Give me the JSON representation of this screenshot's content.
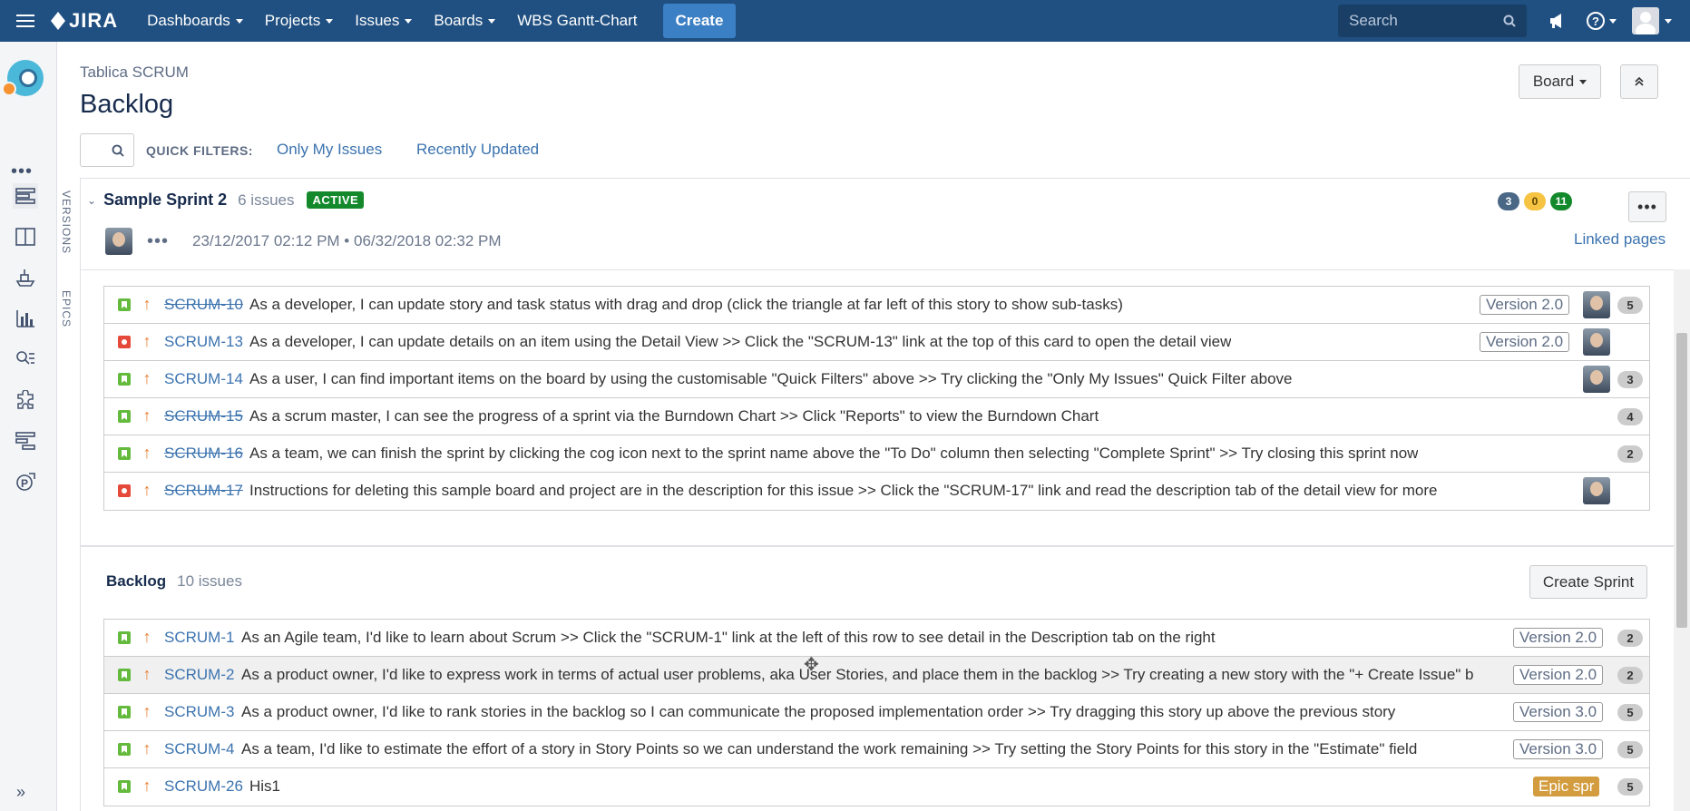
{
  "nav": {
    "logo": "JIRA",
    "items": [
      {
        "label": "Dashboards",
        "has_caret": true
      },
      {
        "label": "Projects",
        "has_caret": true
      },
      {
        "label": "Issues",
        "has_caret": true
      },
      {
        "label": "Boards",
        "has_caret": true
      },
      {
        "label": "WBS Gantt-Chart",
        "has_caret": false
      }
    ],
    "create_label": "Create",
    "search_placeholder": "Search",
    "icons": [
      "megaphone-icon",
      "help-icon",
      "user-avatar"
    ]
  },
  "sidebar": {
    "project_avatar": "project-avatar",
    "icons": [
      "backlog-icon",
      "board-icon",
      "releases-icon",
      "reports-icon",
      "issues-search-icon",
      "components-icon",
      "tests-icon",
      "plugin-icon"
    ],
    "expand_icon": "expand-sidebar-icon"
  },
  "vertical_tabs": [
    "VERSIONS",
    "EPICS"
  ],
  "header": {
    "breadcrumb": "Tablica SCRUM",
    "title": "Backlog",
    "board_button": "Board",
    "quick_filters_label": "QUICK FILTERS:",
    "quick_filters": [
      "Only My Issues",
      "Recently Updated"
    ]
  },
  "sprint": {
    "name": "Sample Sprint 2",
    "issue_count": "6 issues",
    "state": "ACTIVE",
    "dates": "23/12/2017 02:12 PM • 06/32/2018 02:32 PM",
    "status_counts": [
      {
        "value": "3",
        "color": "#4a6785"
      },
      {
        "value": "0",
        "color": "#f6c342"
      },
      {
        "value": "11",
        "color": "#14892c"
      }
    ],
    "linked_pages": "Linked pages",
    "issues": [
      {
        "type": "story",
        "key": "SCRUM-10",
        "done": true,
        "summary": "As a developer, I can update story and task status with drag and drop (click the triangle at far left of this story to show sub-tasks)",
        "version": "Version 2.0",
        "assignee": true,
        "points": "5"
      },
      {
        "type": "bug",
        "key": "SCRUM-13",
        "done": false,
        "summary": "As a developer, I can update details on an item using the Detail View >> Click the \"SCRUM-13\" link at the top of this card to open the detail view",
        "version": "Version 2.0",
        "assignee": true,
        "points": ""
      },
      {
        "type": "story",
        "key": "SCRUM-14",
        "done": false,
        "summary": "As a user, I can find important items on the board by using the customisable \"Quick Filters\" above >> Try clicking the \"Only My Issues\" Quick Filter above",
        "version": "",
        "assignee": true,
        "points": "3"
      },
      {
        "type": "story",
        "key": "SCRUM-15",
        "done": true,
        "summary": "As a scrum master, I can see the progress of a sprint via the Burndown Chart >> Click \"Reports\" to view the Burndown Chart",
        "version": "",
        "assignee": false,
        "points": "4"
      },
      {
        "type": "story",
        "key": "SCRUM-16",
        "done": true,
        "summary": "As a team, we can finish the sprint by clicking the cog icon next to the sprint name above the \"To Do\" column then selecting \"Complete Sprint\" >> Try closing this sprint now",
        "version": "",
        "assignee": false,
        "points": "2"
      },
      {
        "type": "bug",
        "key": "SCRUM-17",
        "done": true,
        "summary": "Instructions for deleting this sample board and project are in the description for this issue >> Click the \"SCRUM-17\" link and read the description tab of the detail view for more",
        "version": "",
        "assignee": true,
        "points": ""
      }
    ]
  },
  "backlog": {
    "title": "Backlog",
    "issue_count": "10 issues",
    "create_sprint": "Create Sprint",
    "issues": [
      {
        "type": "story",
        "key": "SCRUM-1",
        "done": false,
        "summary": "As an Agile team, I'd like to learn about Scrum >> Click the \"SCRUM-1\" link at the left of this row to see detail in the Description tab on the right",
        "version": "Version 2.0",
        "epic": "",
        "points": "2"
      },
      {
        "type": "story",
        "key": "SCRUM-2",
        "done": false,
        "summary": "As a product owner, I'd like to express work in terms of actual user problems, aka User Stories, and place them in the backlog >> Try creating a new story with the \"+ Create Issue\" b",
        "version": "Version 2.0",
        "epic": "",
        "points": "2"
      },
      {
        "type": "story",
        "key": "SCRUM-3",
        "done": false,
        "summary": "As a product owner, I'd like to rank stories in the backlog so I can communicate the proposed implementation order >> Try dragging this story up above the previous story",
        "version": "Version 3.0",
        "epic": "",
        "points": "5"
      },
      {
        "type": "story",
        "key": "SCRUM-4",
        "done": false,
        "summary": "As a team, I'd like to estimate the effort of a story in Story Points so we can understand the work remaining >> Try setting the Story Points for this story in the \"Estimate\" field",
        "version": "Version 3.0",
        "epic": "",
        "points": "5"
      },
      {
        "type": "story",
        "key": "SCRUM-26",
        "done": false,
        "summary": "His1",
        "version": "",
        "epic": "Epic spr",
        "points": "5"
      }
    ]
  }
}
